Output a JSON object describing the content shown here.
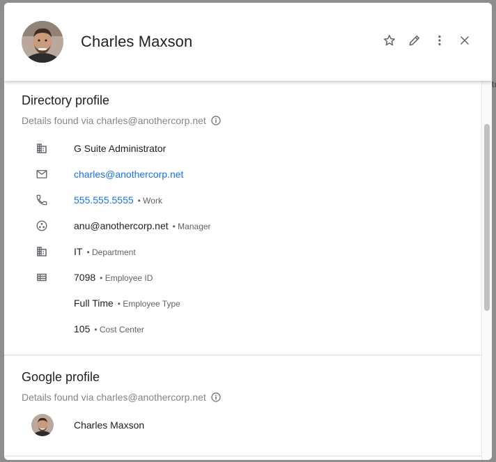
{
  "header": {
    "name": "Charles Maxson",
    "actions": {
      "star_icon": "star-outline-icon",
      "edit_icon": "pencil-icon",
      "more_icon": "more-vert-icon",
      "close_icon": "close-icon"
    }
  },
  "directory_profile": {
    "title": "Directory profile",
    "subtitle": "Details found via charles@anothercorp.net",
    "rows": [
      {
        "icon": "building-icon",
        "value": "G Suite Administrator",
        "sub": ""
      },
      {
        "icon": "email-icon",
        "value": "charles@anothercorp.net",
        "sub": "",
        "link": true
      },
      {
        "icon": "phone-icon",
        "value": "555.555.5555",
        "sub": "• Work",
        "link": true
      },
      {
        "icon": "manager-icon",
        "value": "anu@anothercorp.net",
        "sub": "• Manager"
      },
      {
        "icon": "building-icon",
        "value": "IT",
        "sub": "• Department"
      },
      {
        "icon": "list-icon",
        "value": "7098",
        "sub": "• Employee ID"
      },
      {
        "icon": "",
        "value": "Full Time",
        "sub": "• Employee Type"
      },
      {
        "icon": "",
        "value": "105",
        "sub": "• Cost Center"
      }
    ]
  },
  "google_profile": {
    "title": "Google profile",
    "subtitle": "Details found via charles@anothercorp.net",
    "name": "Charles Maxson"
  },
  "colors": {
    "link": "#1a73e8",
    "text": "#202124",
    "muted": "#80868b",
    "icon": "#5f6368"
  },
  "edge_text": "tı"
}
